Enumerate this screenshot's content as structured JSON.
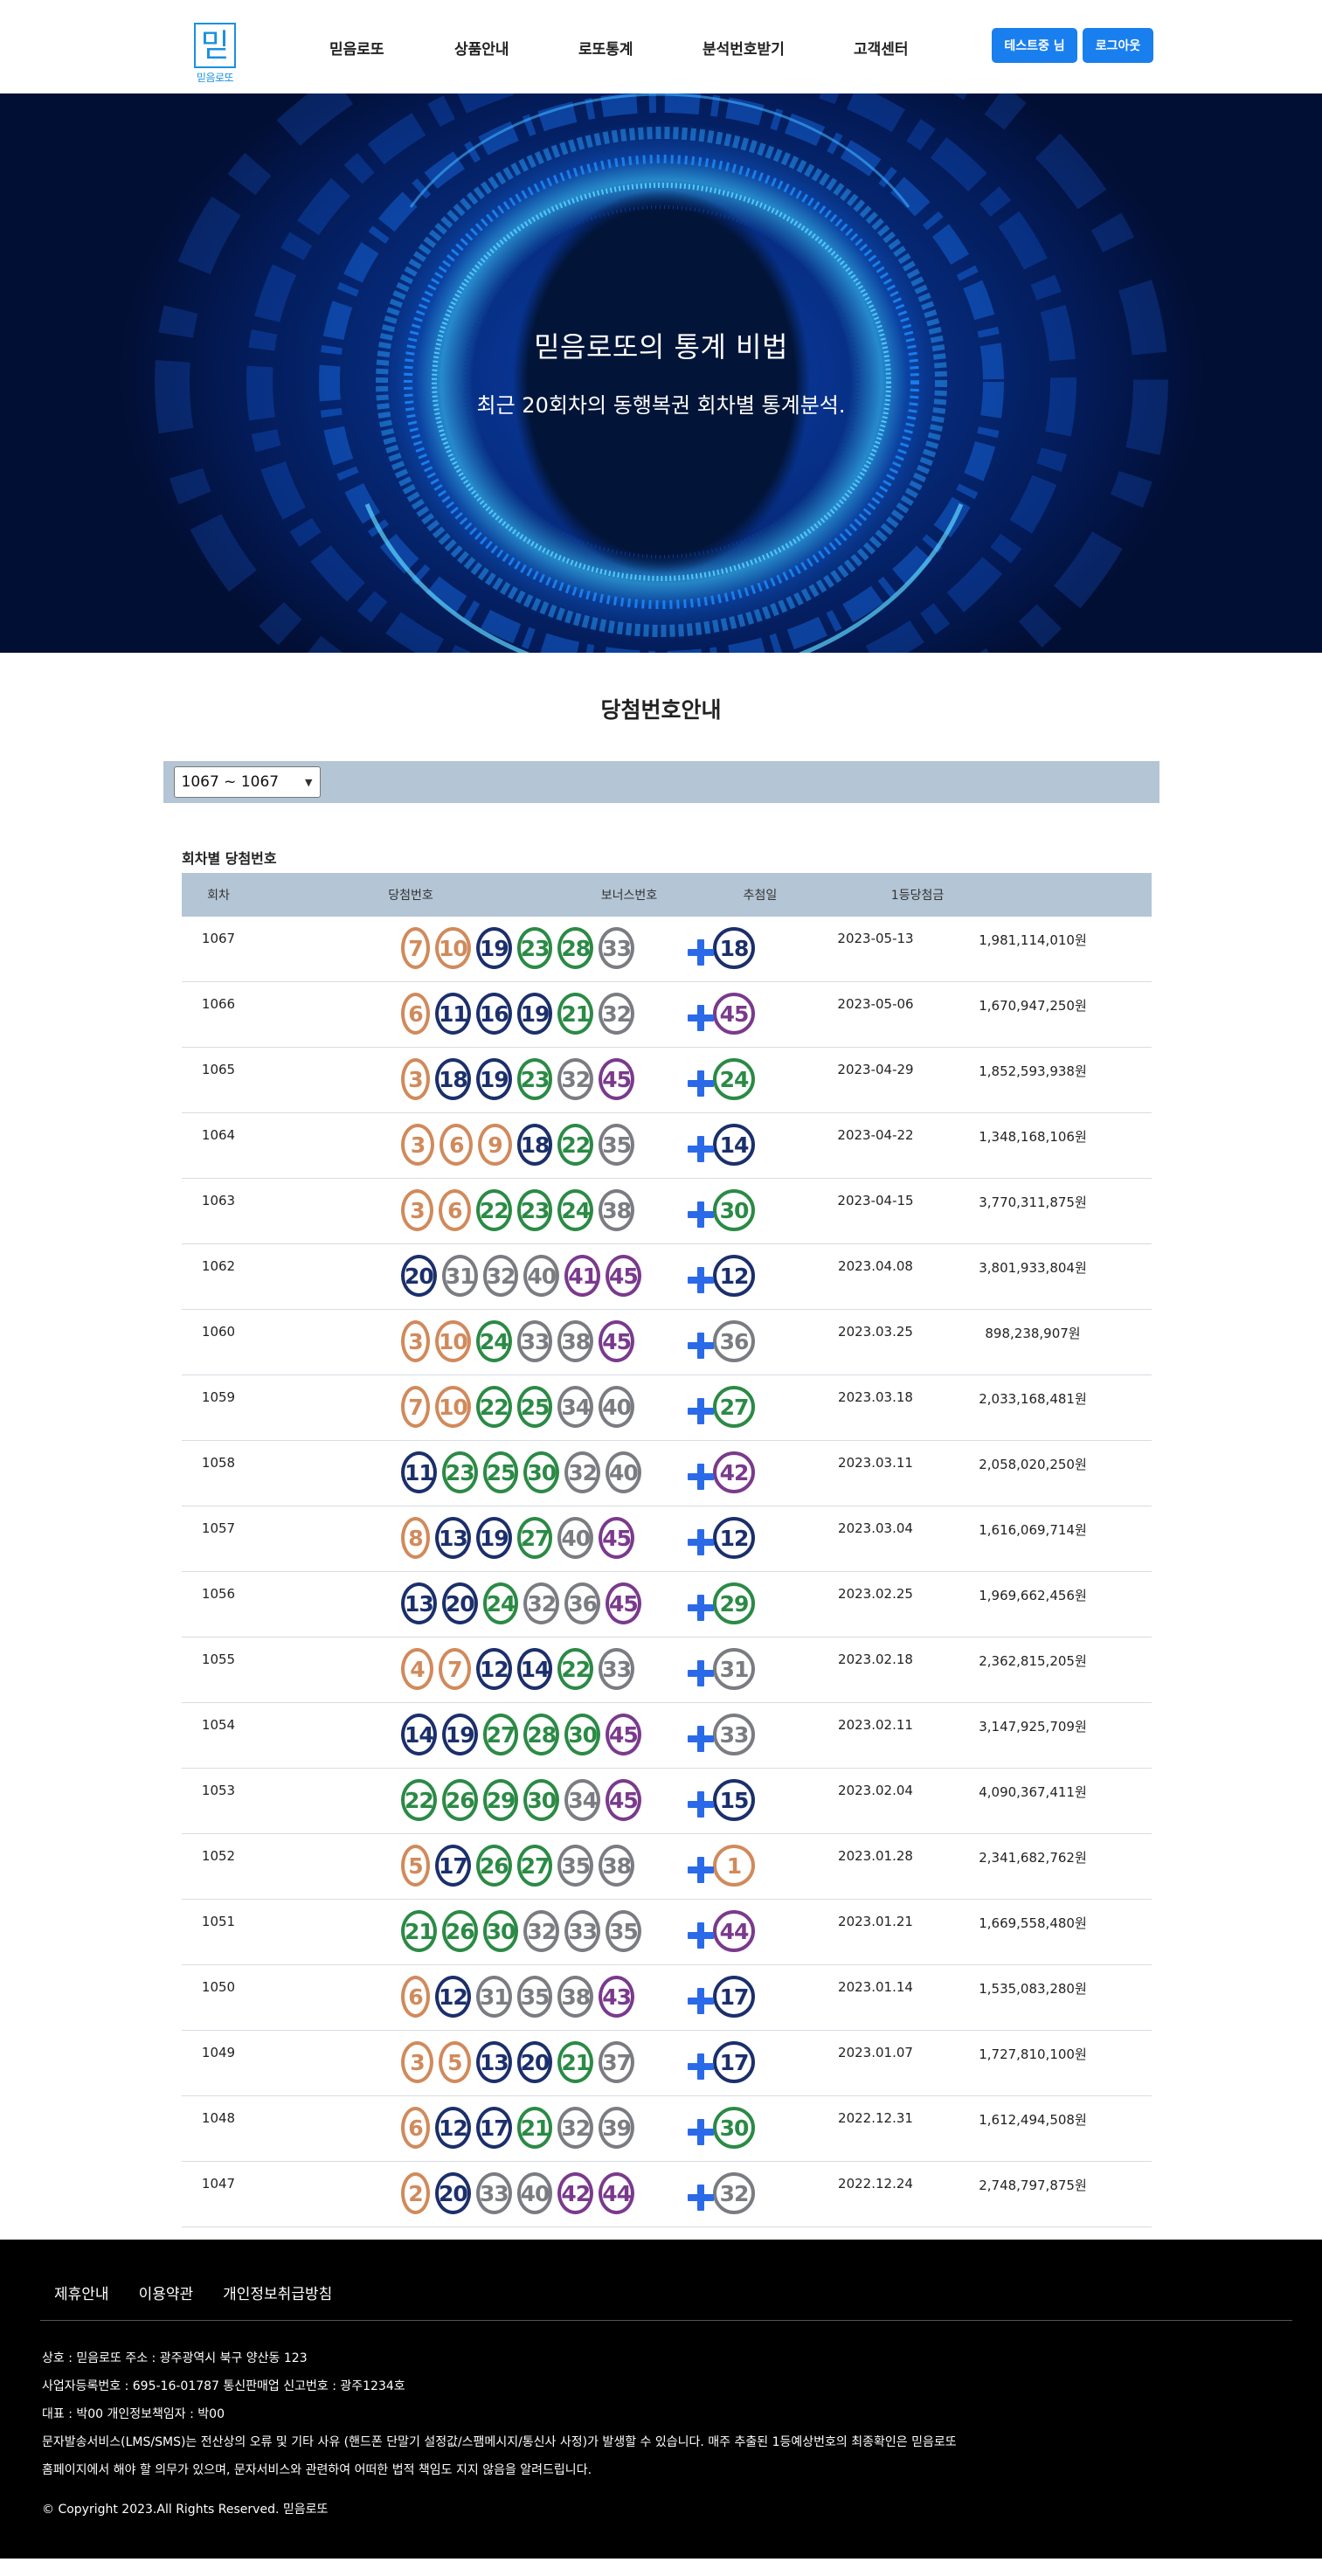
{
  "header": {
    "logo_glyph": "믿",
    "logo_text": "믿음로또",
    "nav": [
      "믿음로또",
      "상품안내",
      "로또통계",
      "분석번호받기",
      "고객센터"
    ],
    "user_button": "테스트중 님",
    "logout_button": "로그아웃"
  },
  "hero": {
    "title": "믿음로또의 통계 비법",
    "subtitle": "최근 20회차의 동행복권 회차별 통계분석."
  },
  "section": {
    "title": "당첨번호안내",
    "select_value": "1067 ~ 1067",
    "subheading": "회차별 당첨번호"
  },
  "table": {
    "headers": [
      "회차",
      "당첨번호",
      "보너스번호",
      "추첨일",
      "1등당첨금"
    ],
    "rows": [
      {
        "round": "1067",
        "nums": [
          7,
          10,
          19,
          23,
          28,
          33
        ],
        "bonus": 18,
        "date": "2023-05-13",
        "prize": "1,981,114,010원"
      },
      {
        "round": "1066",
        "nums": [
          6,
          11,
          16,
          19,
          21,
          32
        ],
        "bonus": 45,
        "date": "2023-05-06",
        "prize": "1,670,947,250원"
      },
      {
        "round": "1065",
        "nums": [
          3,
          18,
          19,
          23,
          32,
          45
        ],
        "bonus": 24,
        "date": "2023-04-29",
        "prize": "1,852,593,938원"
      },
      {
        "round": "1064",
        "nums": [
          3,
          6,
          9,
          18,
          22,
          35
        ],
        "bonus": 14,
        "date": "2023-04-22",
        "prize": "1,348,168,106원"
      },
      {
        "round": "1063",
        "nums": [
          3,
          6,
          22,
          23,
          24,
          38
        ],
        "bonus": 30,
        "date": "2023-04-15",
        "prize": "3,770,311,875원"
      },
      {
        "round": "1062",
        "nums": [
          20,
          31,
          32,
          40,
          41,
          45
        ],
        "bonus": 12,
        "date": "2023.04.08",
        "prize": "3,801,933,804원"
      },
      {
        "round": "1060",
        "nums": [
          3,
          10,
          24,
          33,
          38,
          45
        ],
        "bonus": 36,
        "date": "2023.03.25",
        "prize": "898,238,907원"
      },
      {
        "round": "1059",
        "nums": [
          7,
          10,
          22,
          25,
          34,
          40
        ],
        "bonus": 27,
        "date": "2023.03.18",
        "prize": "2,033,168,481원"
      },
      {
        "round": "1058",
        "nums": [
          11,
          23,
          25,
          30,
          32,
          40
        ],
        "bonus": 42,
        "date": "2023.03.11",
        "prize": "2,058,020,250원"
      },
      {
        "round": "1057",
        "nums": [
          8,
          13,
          19,
          27,
          40,
          45
        ],
        "bonus": 12,
        "date": "2023.03.04",
        "prize": "1,616,069,714원"
      },
      {
        "round": "1056",
        "nums": [
          13,
          20,
          24,
          32,
          36,
          45
        ],
        "bonus": 29,
        "date": "2023.02.25",
        "prize": "1,969,662,456원"
      },
      {
        "round": "1055",
        "nums": [
          4,
          7,
          12,
          14,
          22,
          33
        ],
        "bonus": 31,
        "date": "2023.02.18",
        "prize": "2,362,815,205원"
      },
      {
        "round": "1054",
        "nums": [
          14,
          19,
          27,
          28,
          30,
          45
        ],
        "bonus": 33,
        "date": "2023.02.11",
        "prize": "3,147,925,709원"
      },
      {
        "round": "1053",
        "nums": [
          22,
          26,
          29,
          30,
          34,
          45
        ],
        "bonus": 15,
        "date": "2023.02.04",
        "prize": "4,090,367,411원"
      },
      {
        "round": "1052",
        "nums": [
          5,
          17,
          26,
          27,
          35,
          38
        ],
        "bonus": 1,
        "date": "2023.01.28",
        "prize": "2,341,682,762원"
      },
      {
        "round": "1051",
        "nums": [
          21,
          26,
          30,
          32,
          33,
          35
        ],
        "bonus": 44,
        "date": "2023.01.21",
        "prize": "1,669,558,480원"
      },
      {
        "round": "1050",
        "nums": [
          6,
          12,
          31,
          35,
          38,
          43
        ],
        "bonus": 17,
        "date": "2023.01.14",
        "prize": "1,535,083,280원"
      },
      {
        "round": "1049",
        "nums": [
          3,
          5,
          13,
          20,
          21,
          37
        ],
        "bonus": 17,
        "date": "2023.01.07",
        "prize": "1,727,810,100원"
      },
      {
        "round": "1048",
        "nums": [
          6,
          12,
          17,
          21,
          32,
          39
        ],
        "bonus": 30,
        "date": "2022.12.31",
        "prize": "1,612,494,508원"
      },
      {
        "round": "1047",
        "nums": [
          2,
          20,
          33,
          40,
          42,
          44
        ],
        "bonus": 32,
        "date": "2022.12.24",
        "prize": "2,748,797,875원"
      }
    ]
  },
  "ball_colors": {
    "1-10": "#d18a5b",
    "11-20": "#1b2f6b",
    "21-30": "#2b8a45",
    "31-40": "#7a7c82",
    "41-45": "#7a3a8c",
    "bonus_plus": "#2a6ae8"
  },
  "footer": {
    "links": [
      "제휴안내",
      "이용약관",
      "개인정보취급방침"
    ],
    "info_lines": [
      "상호 : 믿음로또 주소 : 광주광역시 북구 양산동 123",
      "사업자등록번호 : 695-16-01787 통신판매업 신고번호 : 광주1234호",
      "대표 : 박00 개인정보책임자 : 박00",
      "문자발송서비스(LMS/SMS)는 전산상의 오류 및 기타 사유 (핸드폰 단말기 설정값/스팸메시지/통신사 사정)가 발생할 수 있습니다. 매주 추출된 1등예상번호의 최종확인은 믿음로또",
      "홈페이지에서 해야 할 의무가 있으며, 문자서비스와 관련하여 어떠한 법적 책임도 지지 않음을 알려드립니다."
    ],
    "copyright": "© Copyright 2023.All Rights Reserved. 믿음로또"
  }
}
